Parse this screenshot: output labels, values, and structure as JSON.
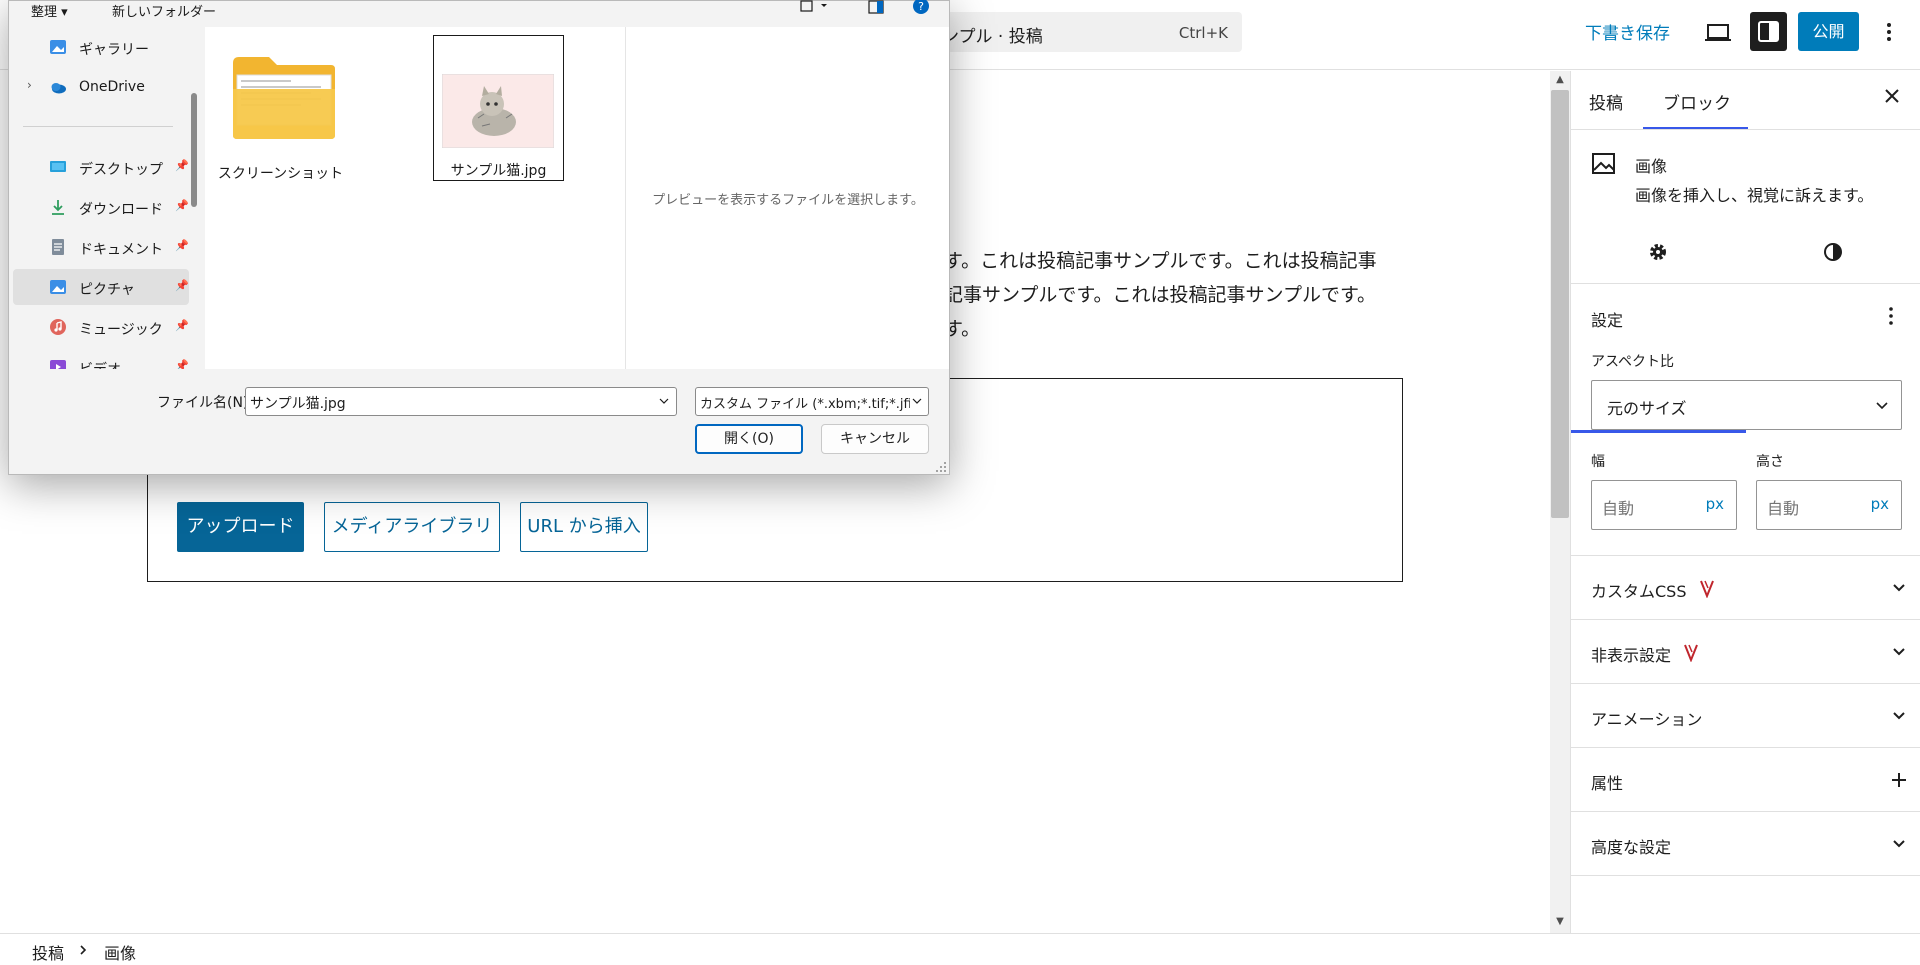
{
  "topbar": {
    "command_text": "ンプル · 投稿",
    "command_shortcut": "Ctrl+K",
    "save_draft": "下書き保存",
    "publish": "公開"
  },
  "editor": {
    "paragraph_lines": [
      "す。これは投稿記事サンプルです。これは投稿記事",
      "記事サンプルです。これは投稿記事サンプルです。",
      "す。"
    ],
    "upload_button": "アップロード",
    "media_library_button": "メディアライブラリ",
    "insert_url_button": "URL から挿入"
  },
  "sidebar": {
    "tabs": [
      "投稿",
      "ブロック"
    ],
    "block_title": "画像",
    "block_description": "画像を挿入し、視覚に訴えます。",
    "settings_label": "設定",
    "aspect_ratio_label": "アスペクト比",
    "aspect_ratio_value": "元のサイズ",
    "width_label": "幅",
    "height_label": "高さ",
    "width_placeholder": "自動",
    "height_placeholder": "自動",
    "unit": "px",
    "panels": [
      "カスタムCSS",
      "非表示設定",
      "アニメーション",
      "属性",
      "高度な設定"
    ]
  },
  "breadcrumb": {
    "items": [
      "投稿",
      "画像"
    ]
  },
  "file_dialog": {
    "toolbar": {
      "organize": "整理",
      "new_folder": "新しいフォルダー"
    },
    "nav_items": [
      {
        "label": "ギャラリー",
        "icon": "gallery-icon"
      },
      {
        "label": "OneDrive",
        "icon": "onedrive-icon"
      },
      {
        "label": "デスクトップ",
        "icon": "desktop-icon"
      },
      {
        "label": "ダウンロード",
        "icon": "download-icon"
      },
      {
        "label": "ドキュメント",
        "icon": "document-icon"
      },
      {
        "label": "ピクチャ",
        "icon": "pictures-icon"
      },
      {
        "label": "ミュージック",
        "icon": "music-icon"
      },
      {
        "label": "ビデオ",
        "icon": "video-icon"
      }
    ],
    "files": [
      {
        "name": "スクリーンショット",
        "type": "folder"
      },
      {
        "name": "サンプル猫.jpg",
        "type": "image"
      }
    ],
    "preview_message": "プレビューを表示するファイルを選択します。",
    "filename_label": "ファイル名(N):",
    "filename_value": "サンプル猫.jpg",
    "filetype_value": "カスタム ファイル (*.xbm;*.tif;*.jfif;*.pjp",
    "open_button": "開く(O)",
    "cancel_button": "キャンセル"
  },
  "colors": {
    "wp_blue": "#007cba",
    "wp_accent": "#3858e9",
    "upload_button_bg": "#066597",
    "dialog_primary_border": "#0067c0"
  }
}
